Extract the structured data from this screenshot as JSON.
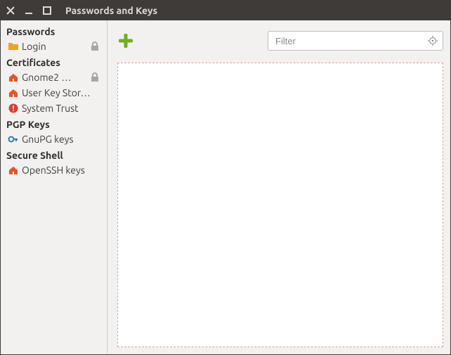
{
  "window": {
    "title": "Passwords and Keys"
  },
  "toolbar": {
    "filter_placeholder": "Filter"
  },
  "sidebar": {
    "sections": {
      "passwords": {
        "header": "Passwords",
        "items": {
          "login": "Login"
        }
      },
      "certificates": {
        "header": "Certificates",
        "items": {
          "gnome2": "Gnome2 …",
          "user_key_store": "User Key Stor…",
          "system_trust": "System Trust"
        }
      },
      "pgp": {
        "header": "PGP Keys",
        "items": {
          "gnupg": "GnuPG keys"
        }
      },
      "ssh": {
        "header": "Secure Shell",
        "items": {
          "openssh": "OpenSSH keys"
        }
      }
    }
  }
}
